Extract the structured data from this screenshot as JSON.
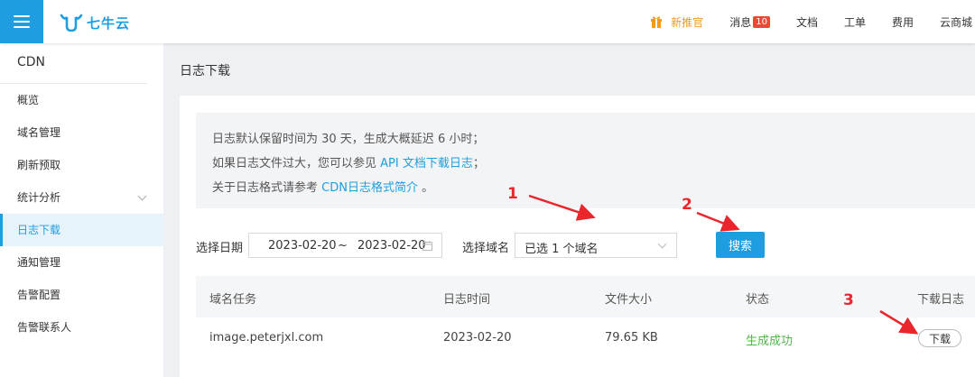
{
  "header": {
    "logo_text": "七牛云",
    "nav": [
      {
        "label": "新推官",
        "badge": ""
      },
      {
        "label": "消息",
        "badge": "10"
      },
      {
        "label": "文档",
        "badge": ""
      },
      {
        "label": "工单",
        "badge": ""
      },
      {
        "label": "费用",
        "badge": ""
      },
      {
        "label": "云商城",
        "badge": ""
      }
    ]
  },
  "sidebar": {
    "title": "CDN",
    "items": [
      {
        "label": "概览"
      },
      {
        "label": "域名管理"
      },
      {
        "label": "刷新预取"
      },
      {
        "label": "统计分析"
      },
      {
        "label": "日志下载"
      },
      {
        "label": "通知管理"
      },
      {
        "label": "告警配置"
      },
      {
        "label": "告警联系人"
      }
    ]
  },
  "main": {
    "page_title": "日志下载",
    "notice": {
      "line1": "日志默认保留时间为 30 天，生成大概延迟 6 小时；",
      "line2_prefix": "如果日志文件过大，您可以参见 ",
      "line2_link": "API 文档下载日志",
      "line2_suffix": "；",
      "line3_prefix": "关于日志格式请参考 ",
      "line3_link": "CDN日志格式简介",
      "line3_suffix": " 。"
    },
    "filter": {
      "date_label": "选择日期",
      "start_date": "2023-02-20",
      "date_sep": "~",
      "end_date": "2023-02-20",
      "domain_label": "选择域名",
      "domain_value": "已选 1 个域名",
      "search_label": "搜索"
    },
    "table": {
      "headers": [
        "域名任务",
        "日志时间",
        "文件大小",
        "状态",
        "下载日志"
      ],
      "rows": [
        {
          "domain": "image.peterjxl.com",
          "time": "2023-02-20",
          "size": "79.65 KB",
          "status": "生成成功",
          "action": "下载"
        }
      ]
    }
  },
  "annotations": {
    "labels": [
      "1",
      "2",
      "3"
    ],
    "color": "#e8262b"
  },
  "colors": {
    "accent": "#1e9ee0",
    "success": "#52b54a",
    "warning": "#f29a1b",
    "badge": "#e84a34"
  }
}
